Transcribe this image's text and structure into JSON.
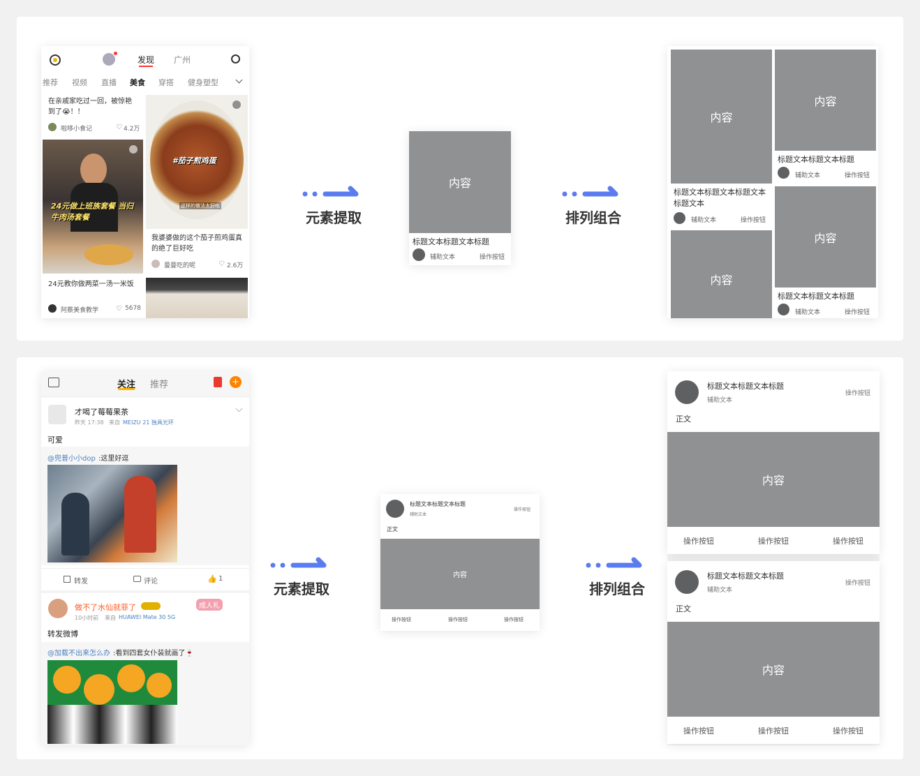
{
  "top": {
    "phone": {
      "header_tabs": [
        "发现",
        "广州"
      ],
      "categories": [
        "推荐",
        "视频",
        "直播",
        "美食",
        "穿搭",
        "健身塑型"
      ],
      "feed": [
        {
          "text": "在亲戚家吃过一回，被惊艳到了😭！！",
          "author": "啦哆小食记",
          "likes": "4.2万"
        },
        {
          "overlay": "24元做上班族套餐 当归牛肉汤套餐",
          "text": "24元教你做两菜一汤一米饭",
          "author": "阿蔡美食教学",
          "likes": "5678"
        },
        {
          "overlay": "#茄子煎鸡蛋",
          "caption": "这样的做法太好吃",
          "text": "我婆婆做的这个茄子煎鸡蛋真的绝了巨好吃",
          "author": "曼曼吃的呢",
          "likes": "2.6万"
        }
      ]
    },
    "arrow1_label": "元素提取",
    "arrow2_label": "排列组合",
    "element": {
      "content": "内容",
      "title": "标题文本标题文本标题",
      "aux": "辅助文本",
      "action": "操作按钮"
    },
    "grid": {
      "content": "内容",
      "title_long": "标题文本标题文本标题文本标题文本",
      "title": "标题文本标题文本标题",
      "aux": "辅助文本",
      "action": "操作按钮"
    }
  },
  "bottom": {
    "phone": {
      "tabs": [
        "关注",
        "推荐"
      ],
      "post1": {
        "name": "才喝了莓莓果茶",
        "meta_time": "昨天 17:38",
        "meta_from": "来自",
        "meta_device": "MEIZU 21 独具光环",
        "body": "可爱",
        "repost_user": "@兜普小小dop",
        "repost_text": ":这里好逗",
        "actions": [
          "转发",
          "评论",
          "1"
        ]
      },
      "post2": {
        "name": "做不了水仙就菲了",
        "meta_time": "10小时前",
        "meta_from": "来自",
        "meta_device": "HUAWEI Mate 30 5G",
        "sticker": "成人礼",
        "body": "转发微博",
        "repost_user": "@加载不出来怎么办",
        "repost_text": ":看到四套女仆装就画了🍷"
      }
    },
    "arrow1_label": "元素提取",
    "arrow2_label": "排列组合",
    "card": {
      "title": "标题文本标题文本标题",
      "aux": "辅助文本",
      "action": "操作按钮",
      "body": "正文",
      "content": "内容",
      "footer": [
        "操作按钮",
        "操作按钮",
        "操作按钮"
      ]
    }
  },
  "colors": {
    "placeholder": "#8f9193",
    "arrow": "#5b7cf0",
    "link": "#4a7fbf",
    "accent": "#ff8200"
  }
}
